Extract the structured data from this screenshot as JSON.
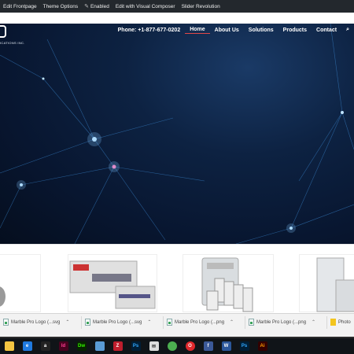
{
  "admin_bar": {
    "items": [
      {
        "label": "Edit Frontpage"
      },
      {
        "label": "Theme Options"
      },
      {
        "label": "Enabled"
      },
      {
        "label": "Edit with Visual Composer"
      },
      {
        "label": "Slider Revolution"
      }
    ]
  },
  "site": {
    "logo_tag": "ICATIONS INC.",
    "nav": {
      "phone": "Phone: +1-877-677-0202",
      "items": [
        "Home",
        "About Us",
        "Solutions",
        "Products",
        "Contact"
      ],
      "active": "Home"
    }
  },
  "downloads": [
    {
      "label": "Marble Pro Logo (...svg",
      "icon": "svg-file-icon"
    },
    {
      "label": "Marble Pro Logo (...svg",
      "icon": "svg-file-icon"
    },
    {
      "label": "Marble Pro Logo (...png",
      "icon": "png-file-icon"
    },
    {
      "label": "Marble Pro Logo (...png",
      "icon": "png-file-icon"
    },
    {
      "label": "Photo",
      "icon": "pdf-file-icon"
    }
  ],
  "taskbar": {
    "apps": [
      {
        "name": "file-explorer-icon",
        "color": "#f4c542"
      },
      {
        "name": "edge-icon",
        "color": "#1f7ae0"
      },
      {
        "name": "amazon-icon",
        "color": "#222"
      },
      {
        "name": "indesign-icon",
        "color": "#49021f"
      },
      {
        "name": "dreamweaver-icon",
        "color": "#072401"
      },
      {
        "name": "notepad-icon",
        "color": "#5a9bd5"
      },
      {
        "name": "filezilla-icon",
        "color": "#bf1e2d"
      },
      {
        "name": "photoshop-icon",
        "color": "#001e36"
      },
      {
        "name": "mail-icon",
        "color": "#ddd"
      },
      {
        "name": "chrome-icon",
        "color": "#4caf50"
      },
      {
        "name": "opera-icon",
        "color": "#e0282c"
      },
      {
        "name": "facebook-icon",
        "color": "#3b5998"
      },
      {
        "name": "word-icon",
        "color": "#2b579a"
      },
      {
        "name": "photoshop-icon-2",
        "color": "#001e36"
      },
      {
        "name": "illustrator-icon",
        "color": "#330000"
      }
    ]
  }
}
